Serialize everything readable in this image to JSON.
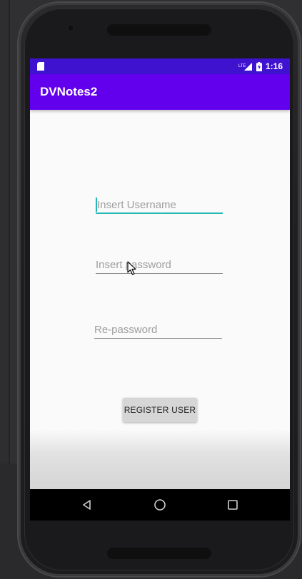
{
  "status_bar": {
    "time": "1:16",
    "network_label": "LTE"
  },
  "app_bar": {
    "title": "DVNotes2"
  },
  "form": {
    "username_placeholder": "Insert Username",
    "password_placeholder": "Insert password",
    "repassword_placeholder": "Re-password",
    "register_label": "REGISTER USER"
  },
  "colors": {
    "status_bar": "#3e12cf",
    "app_bar": "#6200ee",
    "focus_accent": "#26b8b8",
    "button_bg": "#d6d6d6"
  },
  "icons": {
    "status_left": "sd-card-icon",
    "signal": "signal-icon",
    "battery": "battery-icon",
    "nav_back": "back-triangle-icon",
    "nav_home": "home-circle-icon",
    "nav_recents": "recents-square-icon"
  }
}
